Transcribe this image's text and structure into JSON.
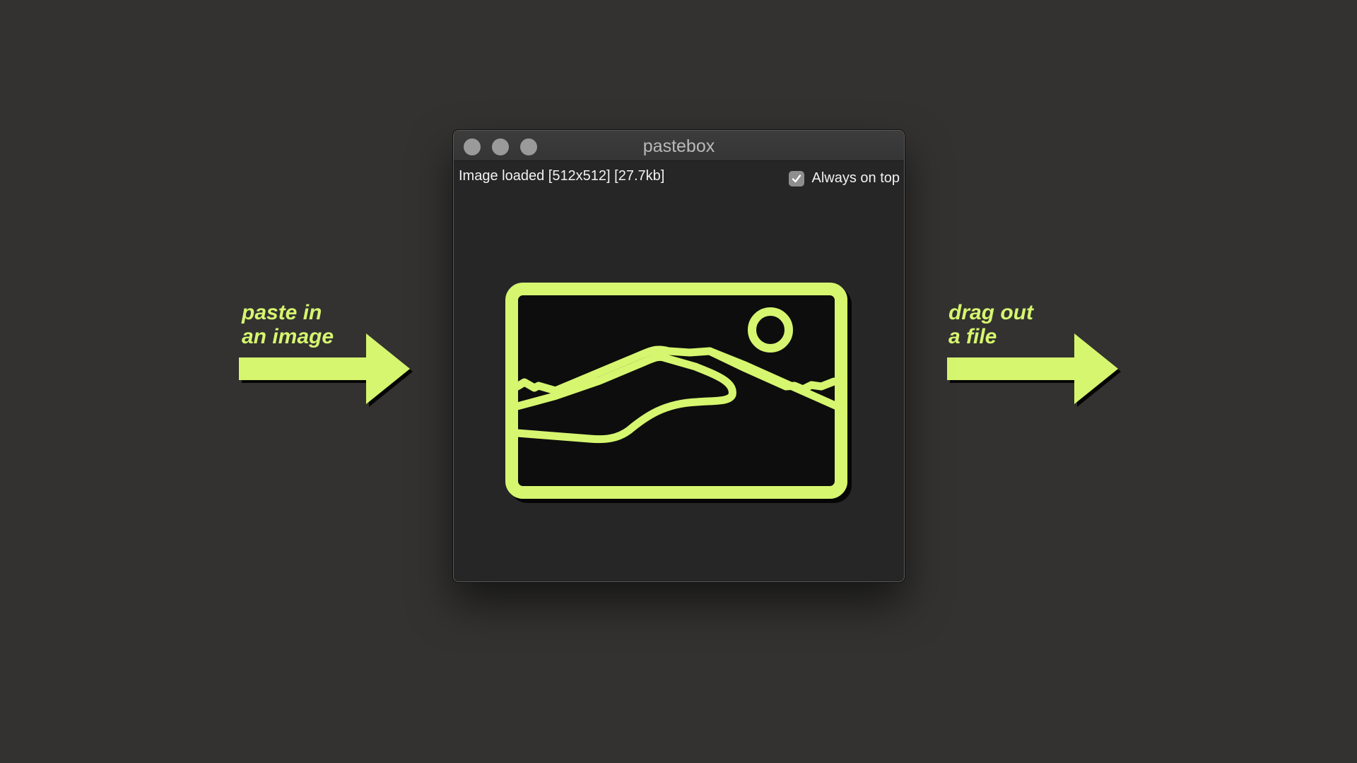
{
  "callouts": {
    "left_line1": "paste in",
    "left_line2": "an image",
    "right_line1": "drag out",
    "right_line2": "a file"
  },
  "window": {
    "title": "pastebox",
    "status_text": "Image loaded [512x512] [27.7kb]",
    "always_on_top": {
      "label": "Always on top",
      "checked": true
    },
    "buttons": [
      "close",
      "minimize",
      "zoom"
    ]
  },
  "preview": {
    "icon": "image-landscape-icon",
    "accent_color": "#d6f66f"
  },
  "colors": {
    "background": "#333231",
    "window": "#262626",
    "accent": "#d6f66f",
    "traffic_light": "#9a9a9a"
  }
}
